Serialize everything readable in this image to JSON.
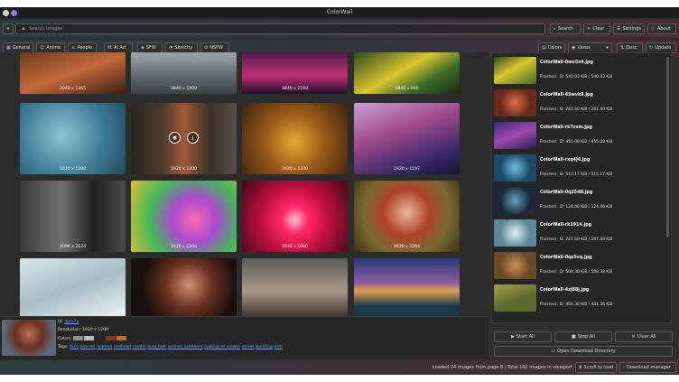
{
  "window": {
    "title": "ColorWall"
  },
  "search": {
    "placeholder": "Search images",
    "search_label": "Search",
    "clear_label": "Clear",
    "settings_label": "Settings",
    "about_label": "About"
  },
  "filters": [
    {
      "label": "General",
      "icon": "grid-icon"
    },
    {
      "label": "Anime",
      "icon": "anime-icon"
    },
    {
      "label": "People",
      "icon": "person-icon"
    },
    {
      "label": "AI Art",
      "icon": "ai-icon"
    },
    {
      "label": "SFW",
      "icon": "shield-icon"
    },
    {
      "label": "Sketchy",
      "icon": "sketchy-icon"
    },
    {
      "label": "NSFW",
      "icon": "block-icon"
    }
  ],
  "toolbar": {
    "colors_label": "Colors",
    "views_label": "Views",
    "desc_label": "Desc",
    "update_label": "Update"
  },
  "gallery": {
    "rows": [
      [
        "2048 x 1365",
        "3840 x 1900",
        "3840 x 2160",
        "3840 x 900"
      ],
      [
        "1920 x 1200",
        "1920 x 1200",
        "1920 x 1200",
        "1920 x 1197"
      ],
      [
        "4096 x 2124",
        "1920 x 1200",
        "1920 x 1080",
        "4928 x 3264"
      ],
      [
        "",
        "",
        "",
        ""
      ]
    ]
  },
  "info": {
    "id_label": "Id:",
    "id_value": "4pm7x",
    "resolution": "Resolution: 1920 x 1200",
    "colors_label": "Colors:",
    "colors": [
      "#8a8f93",
      "#b9bcc0",
      "#2a2422",
      "#7a3a18",
      "#c46a22"
    ],
    "tags_label": "Tags:",
    "tags": [
      "face",
      "blurred",
      "women",
      "redhead",
      "model",
      "long hair",
      "women outdoors",
      "looking at viewer",
      "street",
      "building",
      "arm"
    ]
  },
  "downloads": [
    {
      "name": "ColorWall-0wo5x4.jpg",
      "status": "Finished . D: 540.03 KiB / 540.03 KiB"
    },
    {
      "name": "ColorWall-45wvk8.jpg",
      "status": "Finished . D: 261.40 KiB / 261.40 KiB"
    },
    {
      "name": "ColorWall-rk7zvm.jpg",
      "status": "Finished . D: 455.08 KiB / 455.08 KiB"
    },
    {
      "name": "ColorWall-rxq4j4.jpg",
      "status": "Finished . D: 515.17 KiB / 515.17 KiB"
    },
    {
      "name": "ColorWall-0q25dd.jpg",
      "status": "Finished . D: 124.46 KiB / 124.46 KiB"
    },
    {
      "name": "ColorWall-rk1914.jpg",
      "status": "Finished . D: 267.49 KiB / 267.49 KiB"
    },
    {
      "name": "ColorWall-0qz5vq.jpg",
      "status": "Finished . D: 508.38 KiB / 508.38 KiB"
    },
    {
      "name": "ColorWall-4zj88j.jpg",
      "status": "Finished . D: 481.36 KiB / 481.36 KiB"
    }
  ],
  "download_controls": {
    "start_all": "Start All",
    "stop_all": "Stop All",
    "clear_all": "Clear All",
    "open_dir": "Open Download Directory"
  },
  "status": {
    "text": "Loaded 24 images from page 8 | Total 192 images in viewport",
    "scroll_label": "Scroll to load",
    "manager_label": "Download manager"
  }
}
